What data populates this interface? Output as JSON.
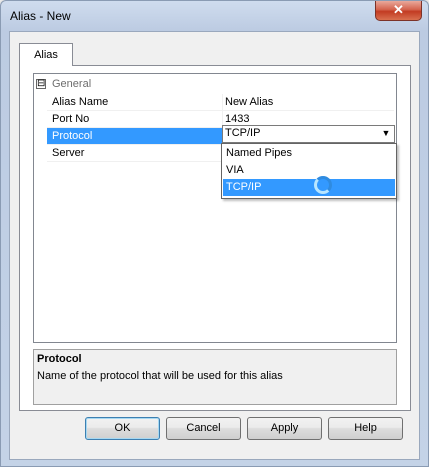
{
  "window": {
    "title": "Alias - New",
    "close_glyph": "✕"
  },
  "tabs": [
    {
      "label": "Alias"
    }
  ],
  "grid": {
    "group": {
      "expander": "⊟",
      "label": "General"
    },
    "properties": [
      {
        "name": "Alias Name",
        "value": "New Alias"
      },
      {
        "name": "Port No",
        "value": "1433"
      },
      {
        "name": "Protocol",
        "value": "TCP/IP"
      },
      {
        "name": "Server",
        "value": ""
      }
    ],
    "combo_arrow": "▼",
    "dropdown_options": [
      {
        "label": "Named Pipes"
      },
      {
        "label": "VIA"
      },
      {
        "label": "TCP/IP"
      }
    ]
  },
  "help": {
    "title": "Protocol",
    "description": "Name of the protocol that will be used for this alias"
  },
  "buttons": {
    "ok": "OK",
    "cancel": "Cancel",
    "apply": "Apply",
    "help": "Help"
  }
}
